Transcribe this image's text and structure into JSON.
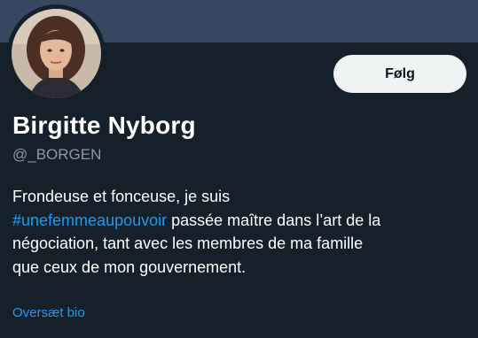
{
  "profile": {
    "name": "Birgitte Nyborg",
    "handle": "@_BORGEN"
  },
  "actions": {
    "follow_label": "Følg"
  },
  "bio": {
    "line1": "Frondeuse et fonceuse, je suis",
    "hashtag": "#unefemmeaupouvoir",
    "line2_rest": " passée maître dans l’art de la",
    "line3": "négociation, tant avec les membres de ma famille",
    "line4": "que ceux de mon gouvernement."
  },
  "translate_label": "Oversæt bio",
  "colors": {
    "background": "#15202b",
    "banner": "#36485f",
    "link": "#1d9bf0",
    "secondary_text": "#8b98a5",
    "button_bg": "#eff3f4"
  }
}
